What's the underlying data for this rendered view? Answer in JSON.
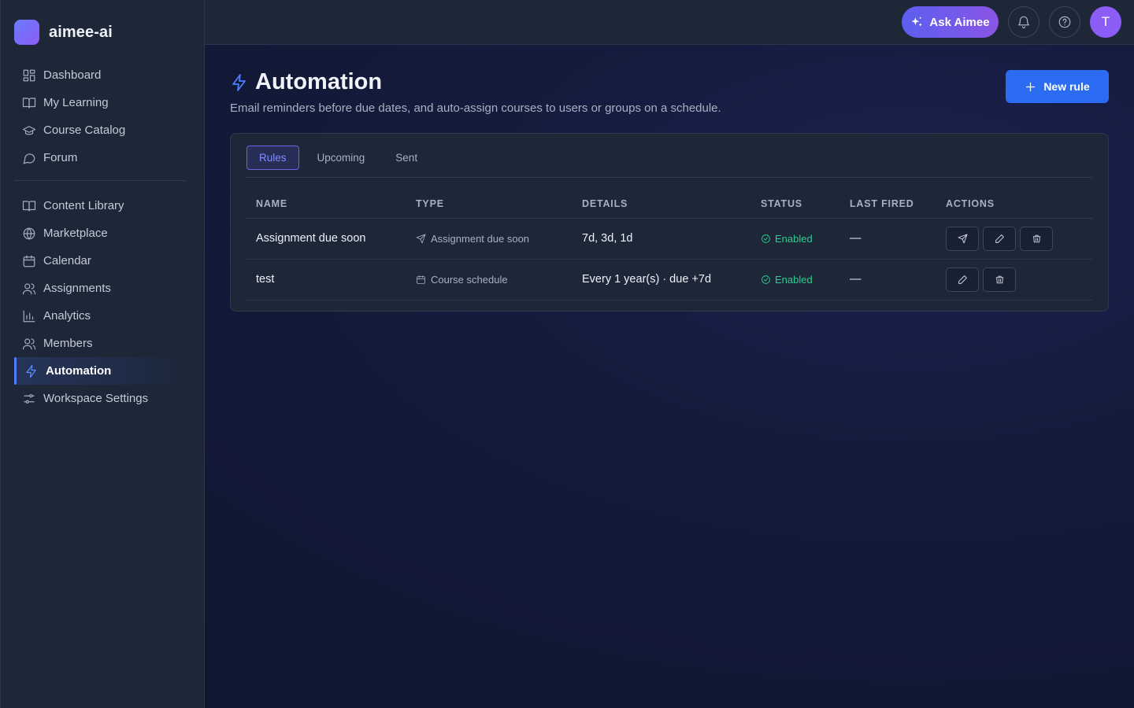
{
  "app": {
    "name": "aimee-ai"
  },
  "sidebar": {
    "primary": [
      {
        "label": "Dashboard",
        "icon": "dashboard-icon"
      },
      {
        "label": "My Learning",
        "icon": "book-icon"
      },
      {
        "label": "Course Catalog",
        "icon": "graduation-cap-icon"
      },
      {
        "label": "Forum",
        "icon": "chat-bubble-icon"
      }
    ],
    "secondary": [
      {
        "label": "Content Library",
        "icon": "book-open-icon"
      },
      {
        "label": "Marketplace",
        "icon": "globe-icon"
      },
      {
        "label": "Calendar",
        "icon": "calendar-icon"
      },
      {
        "label": "Assignments",
        "icon": "users-icon"
      },
      {
        "label": "Analytics",
        "icon": "bar-chart-icon"
      },
      {
        "label": "Members",
        "icon": "users-icon"
      },
      {
        "label": "Automation",
        "icon": "lightning-icon",
        "active": true
      },
      {
        "label": "Workspace Settings",
        "icon": "settings-sliders-icon"
      }
    ]
  },
  "topbar": {
    "ask_label": "Ask Aimee",
    "avatar_initial": "T"
  },
  "page": {
    "title": "Automation",
    "subtitle": "Email reminders before due dates, and auto-assign courses to users or groups on a schedule.",
    "new_rule_label": "New rule"
  },
  "tabs": [
    "Rules",
    "Upcoming",
    "Sent"
  ],
  "active_tab": "Rules",
  "table": {
    "headers": [
      "NAME",
      "TYPE",
      "DETAILS",
      "STATUS",
      "LAST FIRED",
      "ACTIONS"
    ],
    "rows": [
      {
        "name": "Assignment due soon",
        "type": "Assignment due soon",
        "type_icon": "send-icon",
        "details": "7d, 3d, 1d",
        "status": "Enabled",
        "last_fired": "—"
      },
      {
        "name": "test",
        "type": "Course schedule",
        "type_icon": "calendar-icon",
        "details": "Every 1 year(s) · due +7d",
        "status": "Enabled",
        "last_fired": "—"
      }
    ]
  },
  "colors": {
    "accent": "#2c6cf2",
    "active_tab": "#7f8cff",
    "status_enabled": "#2ecc8f"
  }
}
